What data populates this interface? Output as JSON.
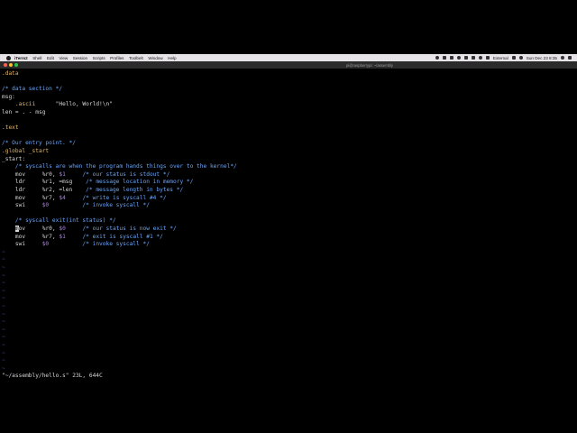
{
  "menubar": {
    "app_name": "iTerm2",
    "menus": [
      "Shell",
      "Edit",
      "View",
      "Session",
      "Scripts",
      "Profiles",
      "Toolbelt",
      "Window",
      "Help"
    ],
    "display_name": "External",
    "clock": "Sun Dec 23  8:35"
  },
  "window": {
    "title": "pi@raspberrypi: ~/assembly"
  },
  "editor": {
    "lines": [
      [
        {
          "t": ".data",
          "c": "directive"
        }
      ],
      [],
      [
        {
          "t": "/* data section */",
          "c": "comment"
        }
      ],
      [
        {
          "t": "msg:",
          "c": "label"
        }
      ],
      [
        {
          "t": "    ",
          "c": "label"
        },
        {
          "t": ".ascii",
          "c": "directive"
        },
        {
          "t": "      \"Hello, World!\\n\"",
          "c": "string"
        }
      ],
      [
        {
          "t": "len = . - msg",
          "c": "op"
        }
      ],
      [],
      [
        {
          "t": ".text",
          "c": "directive"
        }
      ],
      [],
      [
        {
          "t": "/* Our entry point. */",
          "c": "comment"
        }
      ],
      [
        {
          "t": ".global _start",
          "c": "directive"
        }
      ],
      [
        {
          "t": "_start:",
          "c": "label"
        }
      ],
      [
        {
          "t": "    /* syscalls are when the program hands things over to the kernel*/",
          "c": "comment"
        }
      ],
      [
        {
          "t": "    mov     %r0, ",
          "c": "op"
        },
        {
          "t": "$1",
          "c": "imm"
        },
        {
          "t": "     ",
          "c": "op"
        },
        {
          "t": "/* our status is stdout */",
          "c": "comment"
        }
      ],
      [
        {
          "t": "    ldr     %r1, =msg    ",
          "c": "op"
        },
        {
          "t": "/* message location in memory */",
          "c": "comment"
        }
      ],
      [
        {
          "t": "    ldr     %r2, =len    ",
          "c": "op"
        },
        {
          "t": "/* message length in bytes */",
          "c": "comment"
        }
      ],
      [
        {
          "t": "    mov     %r7, ",
          "c": "op"
        },
        {
          "t": "$4",
          "c": "imm"
        },
        {
          "t": "     ",
          "c": "op"
        },
        {
          "t": "/* write is syscall #4 */",
          "c": "comment"
        }
      ],
      [
        {
          "t": "    swi     ",
          "c": "op"
        },
        {
          "t": "$0",
          "c": "imm"
        },
        {
          "t": "          ",
          "c": "op"
        },
        {
          "t": "/* invoke syscall */",
          "c": "comment"
        }
      ],
      [],
      [
        {
          "t": "    /* syscall exit(int status) */",
          "c": "comment"
        }
      ],
      [
        {
          "t": "    ",
          "c": "op"
        },
        {
          "t": "m",
          "c": "cursor"
        },
        {
          "t": "ov     %r0, ",
          "c": "op"
        },
        {
          "t": "$0",
          "c": "imm"
        },
        {
          "t": "     ",
          "c": "op"
        },
        {
          "t": "/* our status is now exit */",
          "c": "comment"
        }
      ],
      [
        {
          "t": "    mov     %r7, ",
          "c": "op"
        },
        {
          "t": "$1",
          "c": "imm"
        },
        {
          "t": "     ",
          "c": "op"
        },
        {
          "t": "/* exit is syscall #1 */",
          "c": "comment"
        }
      ],
      [
        {
          "t": "    swi     ",
          "c": "op"
        },
        {
          "t": "$0",
          "c": "imm"
        },
        {
          "t": "          ",
          "c": "op"
        },
        {
          "t": "/* invoke syscall */",
          "c": "comment"
        }
      ]
    ],
    "tilde_char": "~",
    "tilde_count": 16,
    "status_line": "\"~/assembly/hello.s\" 23L, 644C"
  },
  "colors": {
    "directive": "#e5b567",
    "comment": "#6aa5f7",
    "immediate": "#a97fe0",
    "tilde": "#3b4a8c"
  }
}
